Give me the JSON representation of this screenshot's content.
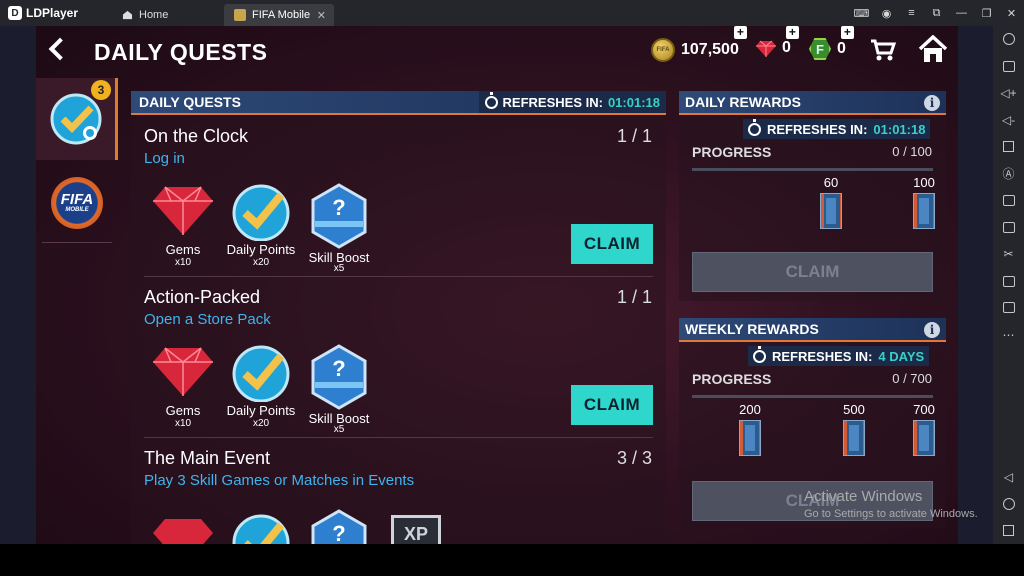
{
  "emulator": {
    "app_name": "LDPlayer",
    "tabs": [
      {
        "label": "Home"
      },
      {
        "label": "FIFA Mobile"
      }
    ]
  },
  "header": {
    "title": "DAILY QUESTS",
    "coins": "107,500",
    "gems": "0",
    "fifa_points": "0"
  },
  "side_tabs": {
    "daily_badge": "3",
    "fifa_logo_line1": "FIFA",
    "fifa_logo_line2": "MOBILE"
  },
  "quests_panel": {
    "heading": "DAILY QUESTS",
    "refresh_label": "REFRESHES IN:",
    "refresh_timer": "01:01:18",
    "quests": [
      {
        "title": "On the Clock",
        "subtitle": "Log in",
        "progress": "1 / 1",
        "claim_label": "CLAIM",
        "rewards": [
          {
            "label": "Gems",
            "qty": "x10",
            "icon": "gem-icon"
          },
          {
            "label": "Daily Points",
            "qty": "x20",
            "icon": "daily-points-icon"
          },
          {
            "label": "Skill Boost",
            "qty": "x5",
            "icon": "skill-boost-icon"
          }
        ]
      },
      {
        "title": "Action-Packed",
        "subtitle": "Open a Store Pack",
        "progress": "1 / 1",
        "claim_label": "CLAIM",
        "rewards": [
          {
            "label": "Gems",
            "qty": "x10",
            "icon": "gem-icon"
          },
          {
            "label": "Daily Points",
            "qty": "x20",
            "icon": "daily-points-icon"
          },
          {
            "label": "Skill Boost",
            "qty": "x5",
            "icon": "skill-boost-icon"
          }
        ]
      },
      {
        "title": "The Main Event",
        "subtitle": "Play 3 Skill Games or Matches in Events",
        "progress": "3 / 3",
        "xp_label": "XP"
      }
    ]
  },
  "daily_rewards": {
    "heading": "DAILY REWARDS",
    "refresh_label": "REFRESHES IN:",
    "refresh_timer": "01:01:18",
    "progress_label": "PROGRESS",
    "progress_value": "0 / 100",
    "milestones": [
      "60",
      "100"
    ],
    "claim_label": "CLAIM"
  },
  "weekly_rewards": {
    "heading": "WEEKLY REWARDS",
    "refresh_label": "REFRESHES IN:",
    "refresh_timer": "4 DAYS",
    "progress_label": "PROGRESS",
    "progress_value": "0 / 700",
    "milestones": [
      "200",
      "500",
      "700"
    ],
    "claim_label": "CLAIM"
  },
  "watermark": {
    "line1": "Activate Windows",
    "line2": "Go to Settings to activate Windows."
  },
  "colors": {
    "accent_teal": "#2fd6cc",
    "panel_blue": "#2e4a78",
    "divider_orange": "#e0783a",
    "link_blue": "#3db4f0"
  }
}
